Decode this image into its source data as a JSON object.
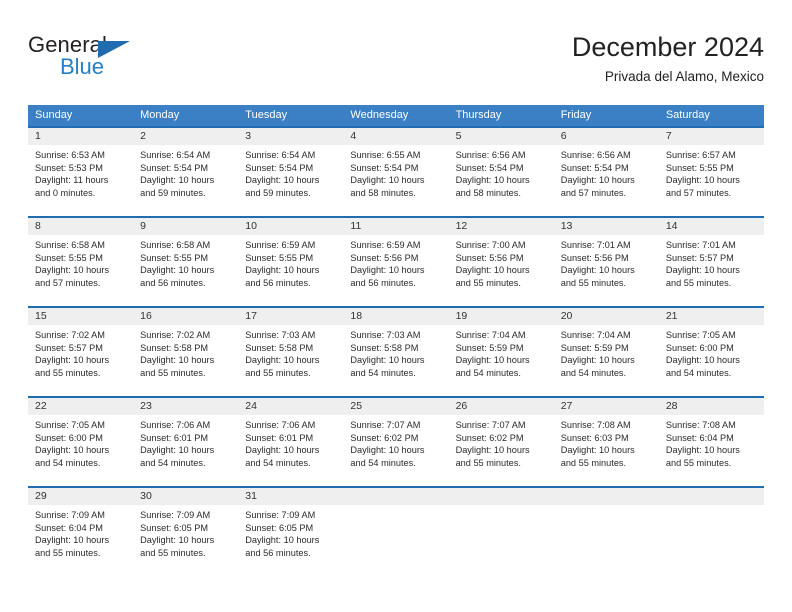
{
  "brand": {
    "name_part1": "General",
    "name_part2": "Blue",
    "logo_icon": "triangle-logo-icon",
    "accent_color": "#1f6cb0",
    "blue_text_color": "#2481c6"
  },
  "header": {
    "title": "December 2024",
    "subtitle": "Privada del Alamo, Mexico"
  },
  "calendar": {
    "header_bg_color": "#3b7fc4",
    "row_border_color": "#1f6cb0",
    "day_band_color": "#efefef",
    "weekdays": [
      "Sunday",
      "Monday",
      "Tuesday",
      "Wednesday",
      "Thursday",
      "Friday",
      "Saturday"
    ],
    "weeks": [
      [
        {
          "day": "1",
          "sunrise": "Sunrise: 6:53 AM",
          "sunset": "Sunset: 5:53 PM",
          "daylight1": "Daylight: 11 hours",
          "daylight2": "and 0 minutes."
        },
        {
          "day": "2",
          "sunrise": "Sunrise: 6:54 AM",
          "sunset": "Sunset: 5:54 PM",
          "daylight1": "Daylight: 10 hours",
          "daylight2": "and 59 minutes."
        },
        {
          "day": "3",
          "sunrise": "Sunrise: 6:54 AM",
          "sunset": "Sunset: 5:54 PM",
          "daylight1": "Daylight: 10 hours",
          "daylight2": "and 59 minutes."
        },
        {
          "day": "4",
          "sunrise": "Sunrise: 6:55 AM",
          "sunset": "Sunset: 5:54 PM",
          "daylight1": "Daylight: 10 hours",
          "daylight2": "and 58 minutes."
        },
        {
          "day": "5",
          "sunrise": "Sunrise: 6:56 AM",
          "sunset": "Sunset: 5:54 PM",
          "daylight1": "Daylight: 10 hours",
          "daylight2": "and 58 minutes."
        },
        {
          "day": "6",
          "sunrise": "Sunrise: 6:56 AM",
          "sunset": "Sunset: 5:54 PM",
          "daylight1": "Daylight: 10 hours",
          "daylight2": "and 57 minutes."
        },
        {
          "day": "7",
          "sunrise": "Sunrise: 6:57 AM",
          "sunset": "Sunset: 5:55 PM",
          "daylight1": "Daylight: 10 hours",
          "daylight2": "and 57 minutes."
        }
      ],
      [
        {
          "day": "8",
          "sunrise": "Sunrise: 6:58 AM",
          "sunset": "Sunset: 5:55 PM",
          "daylight1": "Daylight: 10 hours",
          "daylight2": "and 57 minutes."
        },
        {
          "day": "9",
          "sunrise": "Sunrise: 6:58 AM",
          "sunset": "Sunset: 5:55 PM",
          "daylight1": "Daylight: 10 hours",
          "daylight2": "and 56 minutes."
        },
        {
          "day": "10",
          "sunrise": "Sunrise: 6:59 AM",
          "sunset": "Sunset: 5:55 PM",
          "daylight1": "Daylight: 10 hours",
          "daylight2": "and 56 minutes."
        },
        {
          "day": "11",
          "sunrise": "Sunrise: 6:59 AM",
          "sunset": "Sunset: 5:56 PM",
          "daylight1": "Daylight: 10 hours",
          "daylight2": "and 56 minutes."
        },
        {
          "day": "12",
          "sunrise": "Sunrise: 7:00 AM",
          "sunset": "Sunset: 5:56 PM",
          "daylight1": "Daylight: 10 hours",
          "daylight2": "and 55 minutes."
        },
        {
          "day": "13",
          "sunrise": "Sunrise: 7:01 AM",
          "sunset": "Sunset: 5:56 PM",
          "daylight1": "Daylight: 10 hours",
          "daylight2": "and 55 minutes."
        },
        {
          "day": "14",
          "sunrise": "Sunrise: 7:01 AM",
          "sunset": "Sunset: 5:57 PM",
          "daylight1": "Daylight: 10 hours",
          "daylight2": "and 55 minutes."
        }
      ],
      [
        {
          "day": "15",
          "sunrise": "Sunrise: 7:02 AM",
          "sunset": "Sunset: 5:57 PM",
          "daylight1": "Daylight: 10 hours",
          "daylight2": "and 55 minutes."
        },
        {
          "day": "16",
          "sunrise": "Sunrise: 7:02 AM",
          "sunset": "Sunset: 5:58 PM",
          "daylight1": "Daylight: 10 hours",
          "daylight2": "and 55 minutes."
        },
        {
          "day": "17",
          "sunrise": "Sunrise: 7:03 AM",
          "sunset": "Sunset: 5:58 PM",
          "daylight1": "Daylight: 10 hours",
          "daylight2": "and 55 minutes."
        },
        {
          "day": "18",
          "sunrise": "Sunrise: 7:03 AM",
          "sunset": "Sunset: 5:58 PM",
          "daylight1": "Daylight: 10 hours",
          "daylight2": "and 54 minutes."
        },
        {
          "day": "19",
          "sunrise": "Sunrise: 7:04 AM",
          "sunset": "Sunset: 5:59 PM",
          "daylight1": "Daylight: 10 hours",
          "daylight2": "and 54 minutes."
        },
        {
          "day": "20",
          "sunrise": "Sunrise: 7:04 AM",
          "sunset": "Sunset: 5:59 PM",
          "daylight1": "Daylight: 10 hours",
          "daylight2": "and 54 minutes."
        },
        {
          "day": "21",
          "sunrise": "Sunrise: 7:05 AM",
          "sunset": "Sunset: 6:00 PM",
          "daylight1": "Daylight: 10 hours",
          "daylight2": "and 54 minutes."
        }
      ],
      [
        {
          "day": "22",
          "sunrise": "Sunrise: 7:05 AM",
          "sunset": "Sunset: 6:00 PM",
          "daylight1": "Daylight: 10 hours",
          "daylight2": "and 54 minutes."
        },
        {
          "day": "23",
          "sunrise": "Sunrise: 7:06 AM",
          "sunset": "Sunset: 6:01 PM",
          "daylight1": "Daylight: 10 hours",
          "daylight2": "and 54 minutes."
        },
        {
          "day": "24",
          "sunrise": "Sunrise: 7:06 AM",
          "sunset": "Sunset: 6:01 PM",
          "daylight1": "Daylight: 10 hours",
          "daylight2": "and 54 minutes."
        },
        {
          "day": "25",
          "sunrise": "Sunrise: 7:07 AM",
          "sunset": "Sunset: 6:02 PM",
          "daylight1": "Daylight: 10 hours",
          "daylight2": "and 54 minutes."
        },
        {
          "day": "26",
          "sunrise": "Sunrise: 7:07 AM",
          "sunset": "Sunset: 6:02 PM",
          "daylight1": "Daylight: 10 hours",
          "daylight2": "and 55 minutes."
        },
        {
          "day": "27",
          "sunrise": "Sunrise: 7:08 AM",
          "sunset": "Sunset: 6:03 PM",
          "daylight1": "Daylight: 10 hours",
          "daylight2": "and 55 minutes."
        },
        {
          "day": "28",
          "sunrise": "Sunrise: 7:08 AM",
          "sunset": "Sunset: 6:04 PM",
          "daylight1": "Daylight: 10 hours",
          "daylight2": "and 55 minutes."
        }
      ],
      [
        {
          "day": "29",
          "sunrise": "Sunrise: 7:09 AM",
          "sunset": "Sunset: 6:04 PM",
          "daylight1": "Daylight: 10 hours",
          "daylight2": "and 55 minutes."
        },
        {
          "day": "30",
          "sunrise": "Sunrise: 7:09 AM",
          "sunset": "Sunset: 6:05 PM",
          "daylight1": "Daylight: 10 hours",
          "daylight2": "and 55 minutes."
        },
        {
          "day": "31",
          "sunrise": "Sunrise: 7:09 AM",
          "sunset": "Sunset: 6:05 PM",
          "daylight1": "Daylight: 10 hours",
          "daylight2": "and 56 minutes."
        },
        {
          "day": "",
          "sunrise": "",
          "sunset": "",
          "daylight1": "",
          "daylight2": ""
        },
        {
          "day": "",
          "sunrise": "",
          "sunset": "",
          "daylight1": "",
          "daylight2": ""
        },
        {
          "day": "",
          "sunrise": "",
          "sunset": "",
          "daylight1": "",
          "daylight2": ""
        },
        {
          "day": "",
          "sunrise": "",
          "sunset": "",
          "daylight1": "",
          "daylight2": ""
        }
      ]
    ]
  }
}
